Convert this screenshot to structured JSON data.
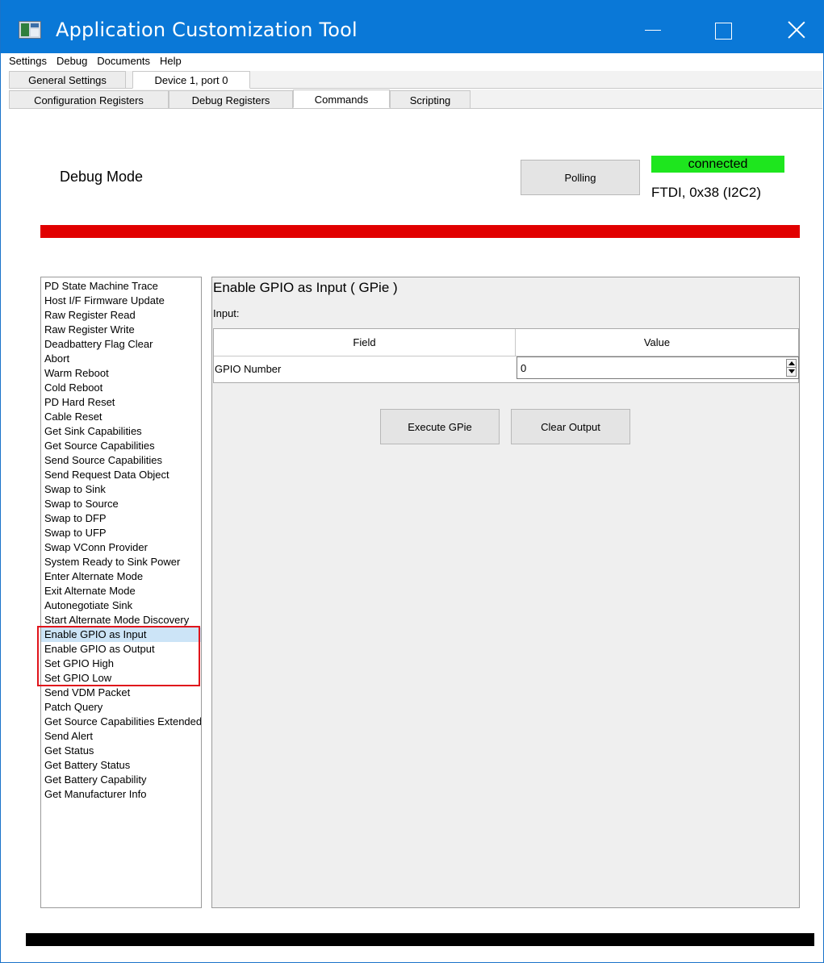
{
  "window": {
    "title": "Application Customization Tool",
    "titlebar_color": "#0a78d7"
  },
  "menu": [
    "Settings",
    "Debug",
    "Documents",
    "Help"
  ],
  "top_tabs": [
    {
      "label": "General Settings",
      "active": false
    },
    {
      "label": "Device 1, port 0",
      "active": true
    }
  ],
  "sub_tabs": [
    {
      "label": "Configuration Registers",
      "active": false
    },
    {
      "label": "Debug Registers",
      "active": false
    },
    {
      "label": "Commands",
      "active": true
    },
    {
      "label": "Scripting",
      "active": false
    }
  ],
  "header": {
    "mode_label": "Debug Mode",
    "polling_label": "Polling",
    "status": "connected",
    "status_color": "#1ee61e",
    "connection": "FTDI, 0x38 (I2C2)"
  },
  "commands": [
    "PD State Machine Trace",
    "Host I/F Firmware Update",
    "Raw Register Read",
    "Raw Register Write",
    "Deadbattery Flag Clear",
    "Abort",
    "Warm Reboot",
    "Cold Reboot",
    "PD Hard Reset",
    "Cable Reset",
    "Get Sink Capabilities",
    "Get Source Capabilities",
    "Send Source Capabilities",
    "Send Request Data Object",
    "Swap to Sink",
    "Swap to Source",
    "Swap to DFP",
    "Swap to UFP",
    "Swap VConn Provider",
    "System Ready to Sink Power",
    "Enter Alternate Mode",
    "Exit Alternate Mode",
    "Autonegotiate Sink",
    "Start Alternate Mode Discovery",
    "Enable GPIO as Input",
    "Enable GPIO as Output",
    "Set GPIO High",
    "Set GPIO Low",
    "Send VDM Packet",
    "Patch Query",
    "Get Source Capabilities Extended",
    "Send Alert",
    "Get Status",
    "Get Battery Status",
    "Get Battery Capability",
    "Get Manufacturer Info"
  ],
  "selected_command": "Enable GPIO as Input",
  "panel": {
    "title": "Enable GPIO as Input  ( GPie )",
    "input_label": "Input:",
    "columns": [
      "Field",
      "Value"
    ],
    "rows": [
      {
        "field": "GPIO Number",
        "value": "0"
      }
    ],
    "execute_label": "Execute GPie",
    "clear_label": "Clear Output"
  },
  "accent_red": "#e10000"
}
